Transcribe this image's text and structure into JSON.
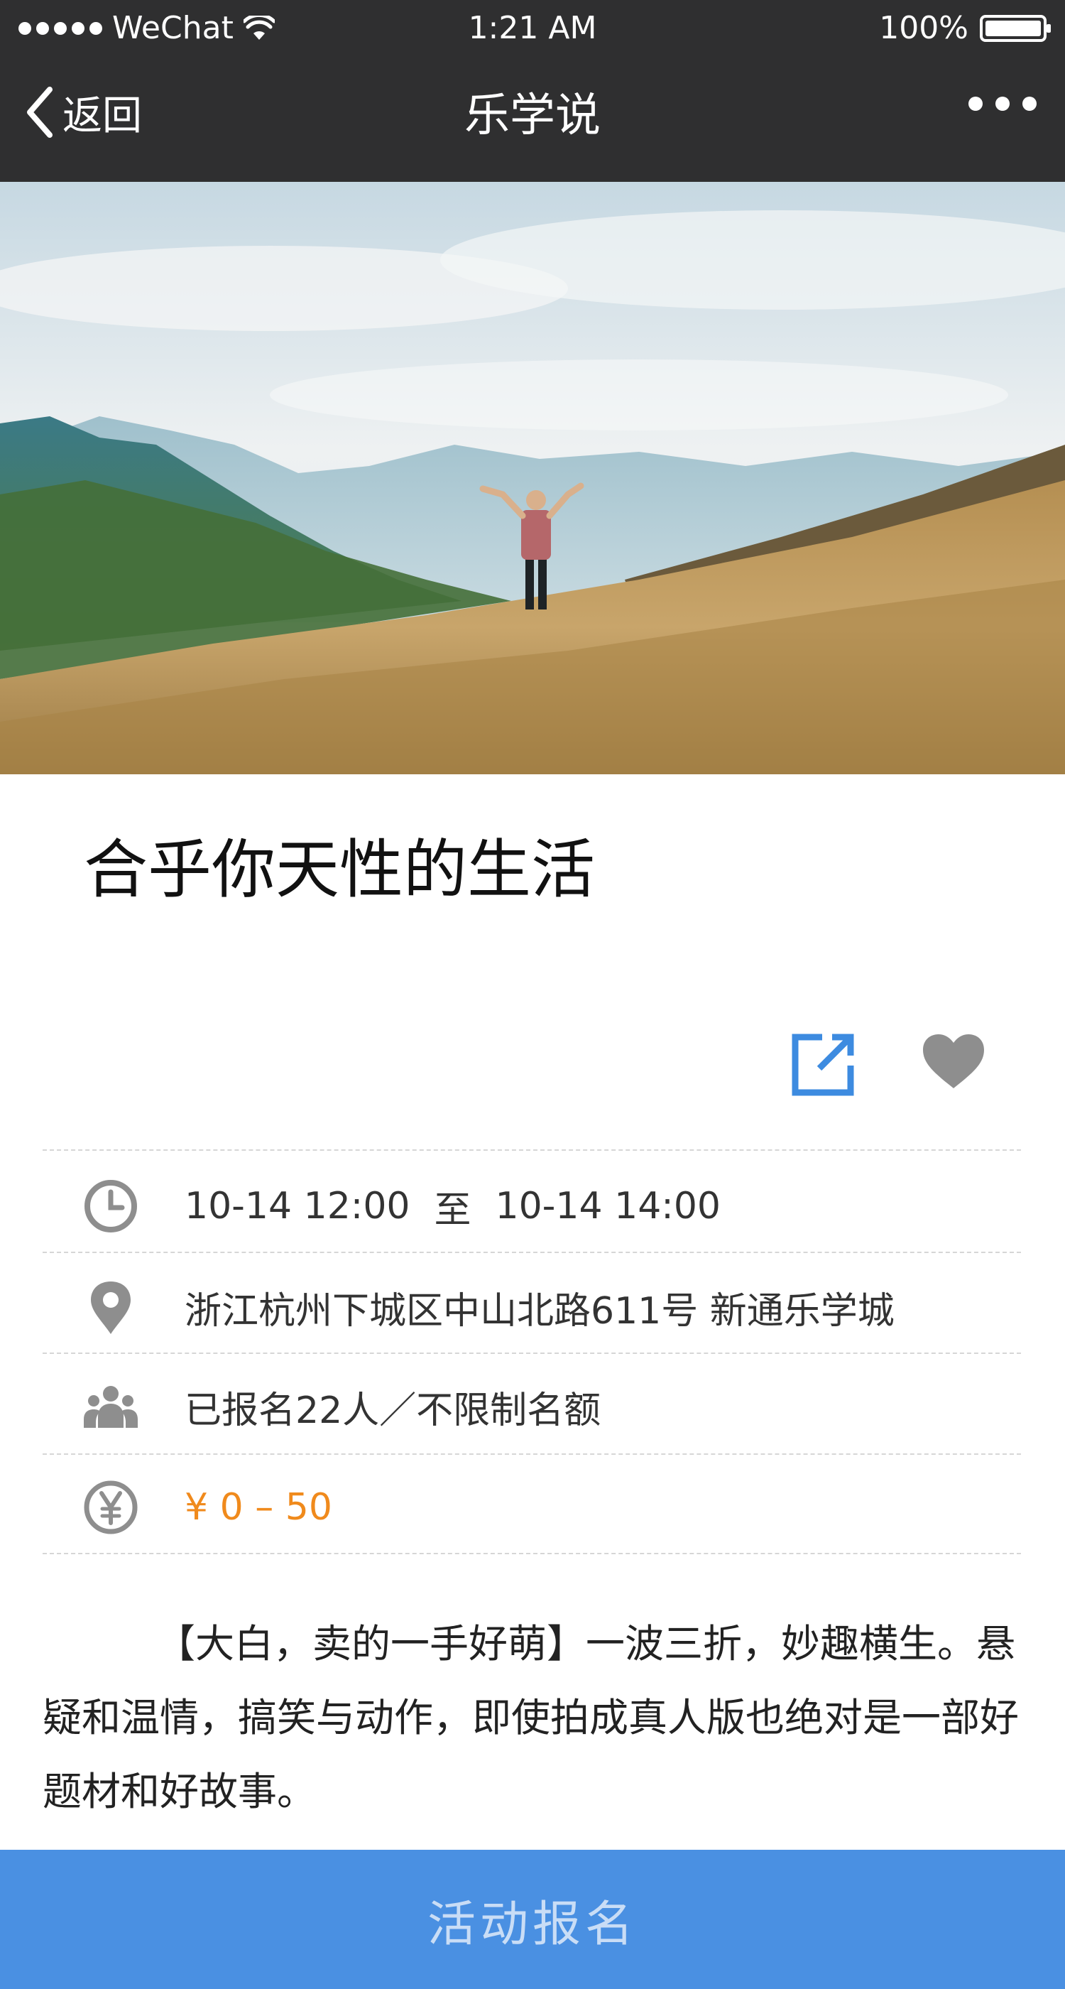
{
  "status_bar": {
    "carrier": "WeChat",
    "time": "1:21 AM",
    "battery": "100%"
  },
  "nav": {
    "back_label": "返回",
    "title": "乐学说"
  },
  "event": {
    "title": "合乎你天性的生活",
    "time_start": "10-14 12:00",
    "time_separator": "至",
    "time_end": "10-14 14:00",
    "address": "浙江杭州下城区中山北路611号 新通乐学城",
    "enrollment": "已报名22人／不限制名额",
    "price": "¥ 0 – 50",
    "description": "【大白，卖的一手好萌】一波三折，妙趣横生。悬疑和温情，搞笑与动作，即使拍成真人版也绝对是一部好题材和好故事。"
  },
  "footer": {
    "signup_label": "活动报名"
  },
  "colors": {
    "bar_bg": "#2f2f30",
    "accent_blue": "#4a90e2",
    "price_orange": "#f08a1c",
    "icon_gray": "#8e8e8e"
  }
}
